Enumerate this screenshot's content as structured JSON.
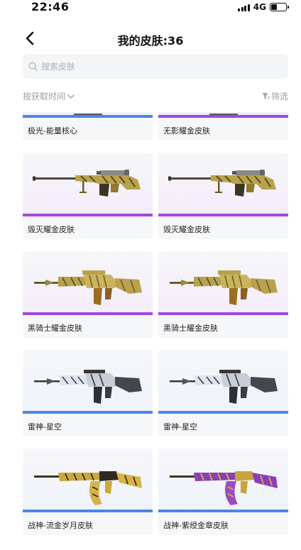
{
  "status": {
    "time": "22:46",
    "network": "4G"
  },
  "nav": {
    "title": "我的皮肤:36"
  },
  "search": {
    "placeholder": "搜索皮肤"
  },
  "filters": {
    "sort_label": "按获取时间",
    "filter_label": "筛选"
  },
  "colors": {
    "blue": "#4a86e8",
    "purple": "#a347d8",
    "blue_tint": "#eef2fa",
    "purple_tint": "#f4ecfa"
  },
  "skins": [
    {
      "name": "极光-能量核心",
      "tier": "blue",
      "weapon": "partial"
    },
    {
      "name": "无影耀金皮肤",
      "tier": "purple",
      "weapon": "partial"
    },
    {
      "name": "毁灭耀金皮肤",
      "tier": "purple",
      "weapon": "sniper-gold"
    },
    {
      "name": "毁灭耀金皮肤",
      "tier": "purple",
      "weapon": "sniper-gold"
    },
    {
      "name": "黑骑士耀金皮肤",
      "tier": "purple",
      "weapon": "m4-gold"
    },
    {
      "name": "黑骑士耀金皮肤",
      "tier": "purple",
      "weapon": "m4-gold"
    },
    {
      "name": "雷神-星空",
      "tier": "blue",
      "weapon": "m4-silver"
    },
    {
      "name": "雷神-星空",
      "tier": "blue",
      "weapon": "m4-silver"
    },
    {
      "name": "战神-流金岁月皮肤",
      "tier": "blue",
      "weapon": "ak-gold"
    },
    {
      "name": "战神-紫绶金章皮肤",
      "tier": "blue",
      "weapon": "ak-purple"
    }
  ]
}
